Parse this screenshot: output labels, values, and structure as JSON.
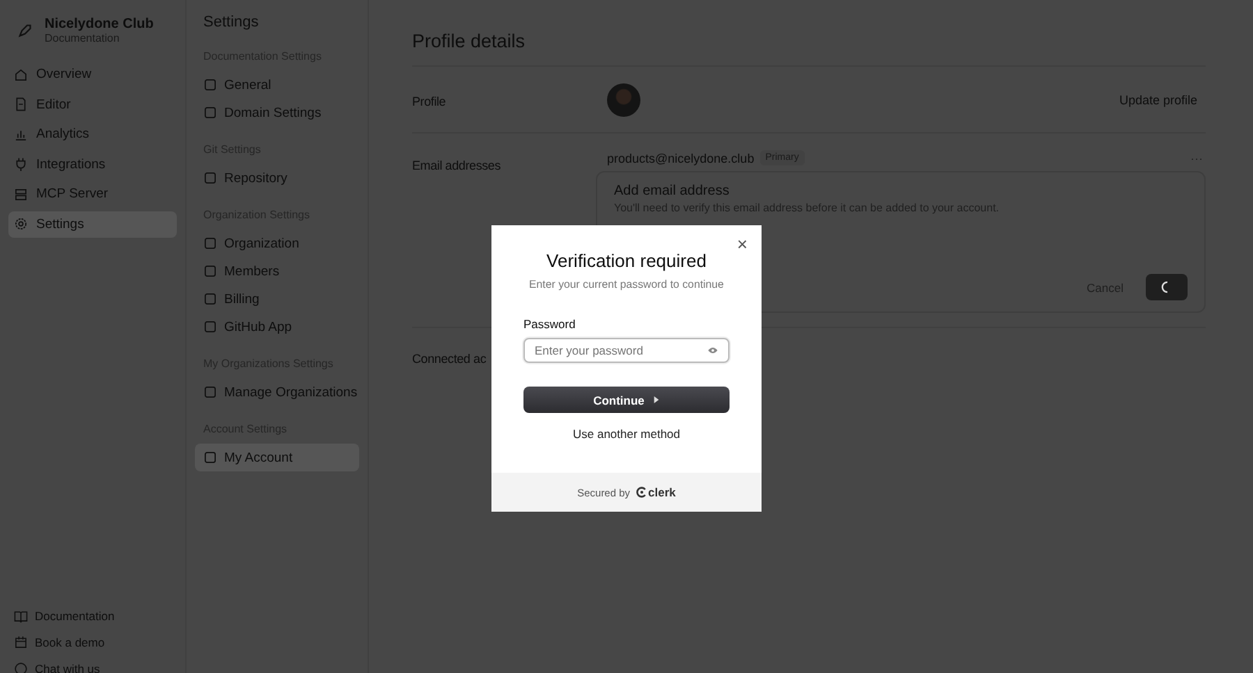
{
  "brand": {
    "name": "Nicelydone Club",
    "subtitle": "Documentation"
  },
  "sidebar": {
    "items": [
      {
        "label": "Overview",
        "selected": false
      },
      {
        "label": "Editor",
        "selected": false
      },
      {
        "label": "Analytics",
        "selected": false
      },
      {
        "label": "Integrations",
        "selected": false
      },
      {
        "label": "MCP Server",
        "selected": false
      },
      {
        "label": "Settings",
        "selected": true
      }
    ],
    "footer_links": [
      "Documentation",
      "Book a demo",
      "Chat with us"
    ]
  },
  "settings_nav": {
    "title": "Settings",
    "groups": [
      {
        "heading": "Documentation Settings",
        "items": [
          {
            "label": "General",
            "selected": false
          },
          {
            "label": "Domain Settings",
            "selected": false
          }
        ]
      },
      {
        "heading": "Git Settings",
        "items": [
          {
            "label": "Repository",
            "selected": false
          }
        ]
      },
      {
        "heading": "Organization Settings",
        "items": [
          {
            "label": "Organization",
            "selected": false
          },
          {
            "label": "Members",
            "selected": false
          },
          {
            "label": "Billing",
            "selected": false
          },
          {
            "label": "GitHub App",
            "selected": false
          }
        ]
      },
      {
        "heading": "My Organizations Settings",
        "items": [
          {
            "label": "Manage Organizations",
            "selected": false
          }
        ]
      },
      {
        "heading": "Account Settings",
        "items": [
          {
            "label": "My Account",
            "selected": true
          }
        ]
      }
    ]
  },
  "main": {
    "title": "Profile details",
    "profile_label": "Profile",
    "update_button": "Update profile",
    "email_label": "Email addresses",
    "email": "products@nicelydone.club",
    "email_badge": "Primary",
    "more_button": "···",
    "add_email": {
      "title": "Add email address",
      "description": "You'll need to verify this email address before it can be added to your account.",
      "cancel": "Cancel"
    },
    "connected_label": "Connected ac"
  },
  "modal": {
    "title": "Verification required",
    "subtitle": "Enter your current password to continue",
    "close": "×",
    "field_label": "Password",
    "placeholder": "Enter your password",
    "continue": "Continue",
    "alt_method": "Use another method",
    "secured_by": "Secured by",
    "provider": "clerk"
  }
}
